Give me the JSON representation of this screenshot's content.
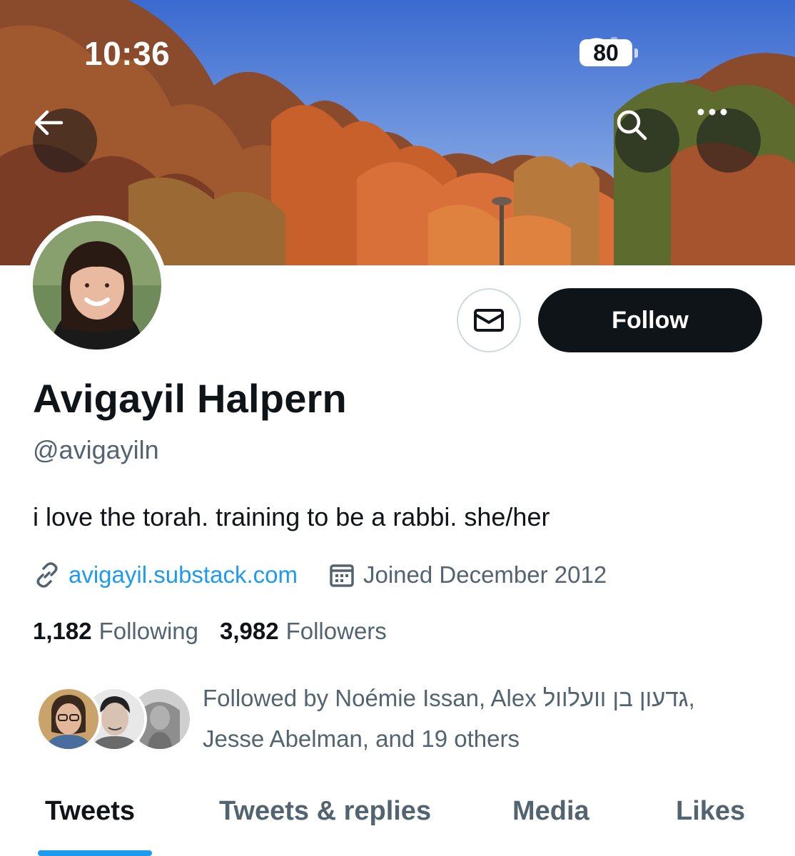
{
  "status_bar": {
    "time": "10:36",
    "battery": "80"
  },
  "header": {
    "back_icon": "arrow-left-icon",
    "search_icon": "search-icon",
    "more_icon": "more-horizontal-icon"
  },
  "profile": {
    "display_name": "Avigayil Halpern",
    "handle": "@avigayiln",
    "bio": "i love the torah. training to be a rabbi. she/her",
    "website": "avigayil.substack.com",
    "joined": "Joined December 2012",
    "following_count": "1,182",
    "following_label": "Following",
    "followers_count": "3,982",
    "followers_label": "Followers",
    "followed_by_line1": "Followed by Noémie Issan, Alex גדעון בן וועלוול,",
    "followed_by_line2": "Jesse Abelman, and 19 others"
  },
  "actions": {
    "follow_label": "Follow",
    "message_icon": "envelope-icon"
  },
  "tabs": [
    {
      "label": "Tweets",
      "active": true
    },
    {
      "label": "Tweets & replies",
      "active": false
    },
    {
      "label": "Media",
      "active": false
    },
    {
      "label": "Likes",
      "active": false
    }
  ],
  "colors": {
    "accent": "#1d9bf0",
    "text_primary": "#0f1419",
    "text_secondary": "#536471",
    "follow_bg": "#0f1419"
  }
}
